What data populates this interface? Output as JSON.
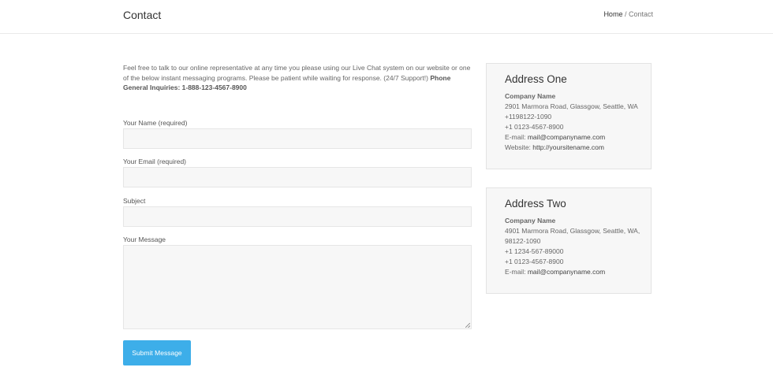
{
  "header": {
    "title": "Contact",
    "breadcrumb": {
      "home": "Home",
      "separator": " / ",
      "current": "Contact"
    }
  },
  "intro": {
    "text": "Feel free to talk to our online representative at any time you please using our Live Chat system on our website or one of the below instant messaging programs. Please be patient while waiting for response. (24/7 Support!) ",
    "phone_label": "Phone General Inquiries: 1-888-123-4567-8900"
  },
  "form": {
    "name_label": "Your Name (required)",
    "name_value": "",
    "email_label": "Your Email (required)",
    "email_value": "",
    "subject_label": "Subject",
    "subject_value": "",
    "message_label": "Your Message",
    "message_value": "",
    "submit_label": "Submit Message"
  },
  "addresses": [
    {
      "title": "Address One",
      "company": "Company Name",
      "lines": [
        "2901 Marmora Road, Glassgow, Seattle, WA",
        "+1198122-1090",
        "+1 0123-4567-8900"
      ],
      "email_label": "E-mail: ",
      "email": "mail@companyname.com",
      "website_label": "Website: ",
      "website": "http://yoursitename.com"
    },
    {
      "title": "Address Two",
      "company": "Company Name",
      "lines": [
        "4901 Marmora Road, Glassgow, Seattle, WA,",
        "98122-1090",
        "+1 1234-567-89000",
        "+1 0123-4567-8900"
      ],
      "email_label": "E-mail: ",
      "email": "mail@companyname.com"
    }
  ],
  "colors": {
    "accent": "#3daee9",
    "field_bg": "#f7f7f7",
    "border": "#e6e6e6"
  }
}
